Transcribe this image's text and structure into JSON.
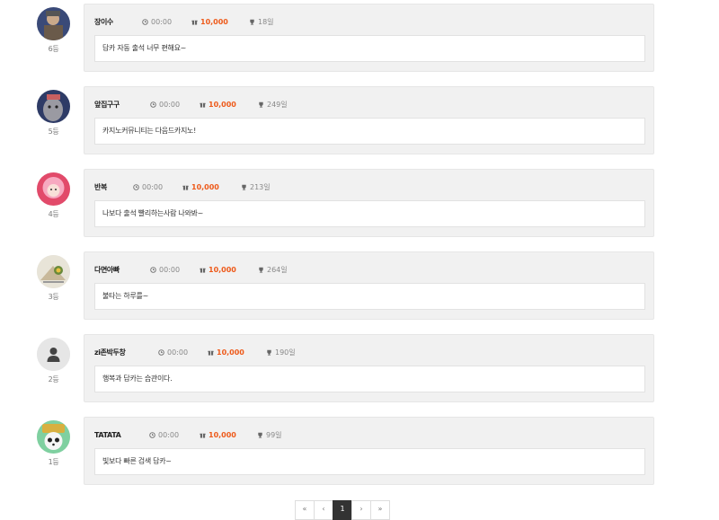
{
  "entries": [
    {
      "name": "장이수",
      "time": "00:00",
      "points": "10,000",
      "days": "18일",
      "rank": "6등",
      "message": "답카 자동 출석 너무 편해요~",
      "avatar": "warrior-avatar"
    },
    {
      "name": "앞집구구",
      "time": "00:00",
      "points": "10,000",
      "days": "249일",
      "rank": "5등",
      "message": "카지노커뮤니티는 다음드카지노!",
      "avatar": "monster-avatar"
    },
    {
      "name": "반복",
      "time": "00:00",
      "points": "10,000",
      "days": "213일",
      "rank": "4등",
      "message": "나보다 출석 빨리하는사람 나와봐~",
      "avatar": "pink-hair-avatar"
    },
    {
      "name": "다면아빠",
      "time": "00:00",
      "points": "10,000",
      "days": "264일",
      "rank": "3등",
      "message": "불타는 하루를~",
      "avatar": "cartoon-avatar"
    },
    {
      "name": "zi존박두창",
      "time": "00:00",
      "points": "10,000",
      "days": "190일",
      "rank": "2등",
      "message": "행복과 답카는 습관이다.",
      "avatar": "default-user-avatar"
    },
    {
      "name": "TATATA",
      "time": "00:00",
      "points": "10,000",
      "days": "99일",
      "rank": "1등",
      "message": "빛보다 빠른 검색 답카~",
      "avatar": "panda-avatar"
    }
  ],
  "pagination": [
    "«",
    "‹",
    "1",
    "›",
    "»"
  ],
  "colors": {
    "points": "#ee5a1a",
    "card": "#f1f1f1",
    "active_page": "#333333"
  },
  "icons": {
    "time": "clock-icon",
    "points": "gift-icon",
    "days": "trophy-icon"
  }
}
